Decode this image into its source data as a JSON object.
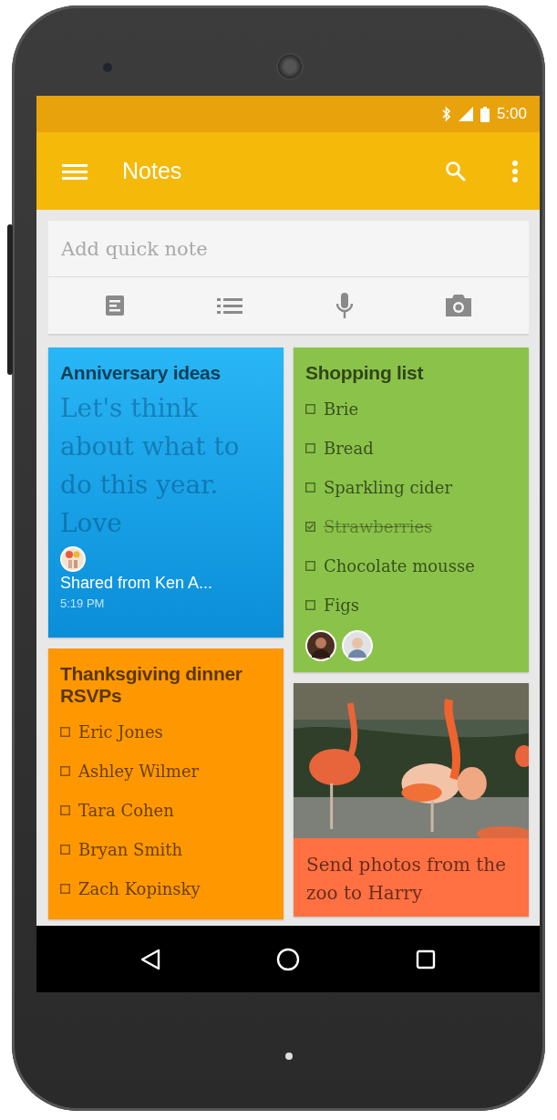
{
  "status_bar": {
    "time": "5:00"
  },
  "toolbar": {
    "title": "Notes"
  },
  "quick_note": {
    "placeholder": "Add quick note"
  },
  "notes": [
    {
      "kind": "text",
      "color": "#29b6f6",
      "title": "Anniversary ideas",
      "body": "Let's think about what to do this year. Love",
      "shared": "Shared from Ken A...",
      "time": "5:19 PM"
    },
    {
      "kind": "checklist",
      "color": "#8bc34a",
      "title": "Shopping list",
      "items": [
        {
          "text": "Brie",
          "checked": false
        },
        {
          "text": "Bread",
          "checked": false
        },
        {
          "text": "Sparkling cider",
          "checked": false
        },
        {
          "text": "Strawberries",
          "checked": true
        },
        {
          "text": "Chocolate mousse",
          "checked": false
        },
        {
          "text": "Figs",
          "checked": false
        }
      ]
    },
    {
      "kind": "checklist",
      "color": "#ff9800",
      "title": "Thanksgiving dinner RSVPs",
      "items": [
        {
          "text": "Eric Jones",
          "checked": false
        },
        {
          "text": "Ashley Wilmer",
          "checked": false
        },
        {
          "text": "Tara Cohen",
          "checked": false
        },
        {
          "text": "Bryan Smith",
          "checked": false
        },
        {
          "text": "Zach Kopinsky",
          "checked": false
        }
      ]
    },
    {
      "color": "#ff7043",
      "body": "Send photos from the zoo to Harry"
    }
  ]
}
